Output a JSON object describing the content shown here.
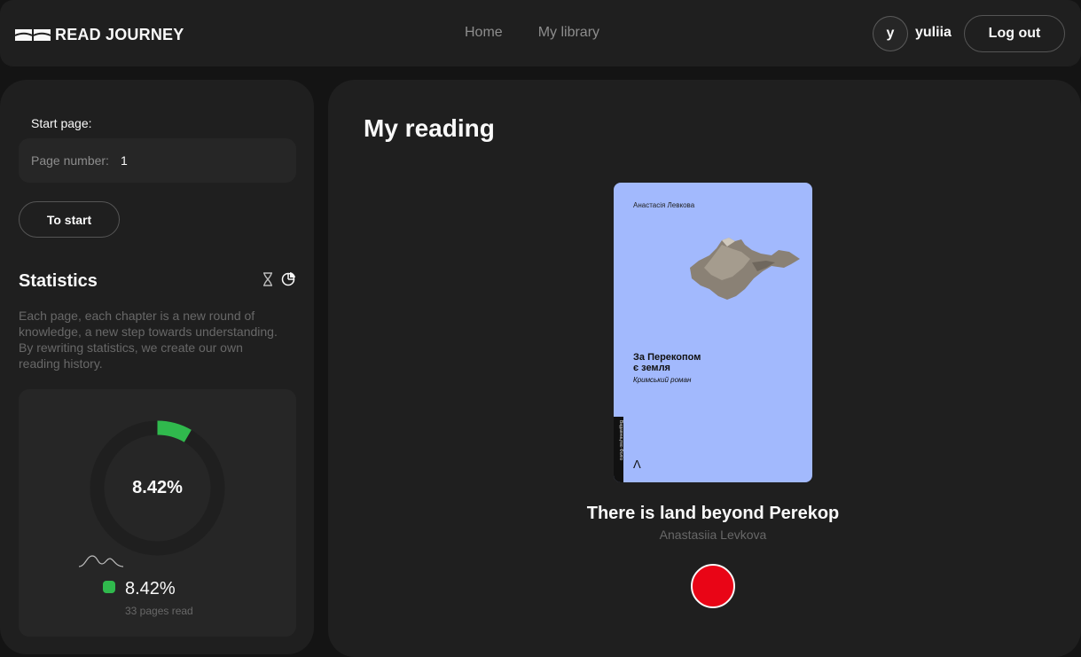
{
  "header": {
    "logo_text": "READ JOURNEY",
    "nav": [
      "Home",
      "My library"
    ],
    "user_initial": "y",
    "user_name": "yuliia",
    "logout_label": "Log out"
  },
  "sidebar": {
    "start_label": "Start page:",
    "page_input": {
      "placeholder": "Page number:",
      "value": "1"
    },
    "to_start_label": "To start",
    "stats_title": "Statistics",
    "stats_desc": "Each page, each chapter is a new round of knowledge, a new step towards understanding. By rewriting statistics, we create our own reading history.",
    "progress": {
      "percent_text": "8.42%",
      "fraction": 0.0842,
      "pages_read": "33 pages read"
    }
  },
  "main": {
    "title": "My reading",
    "book": {
      "title": "There is land beyond Perekop",
      "author": "Anastasiia Levkova",
      "cover": {
        "author": "Анастасія Левкова",
        "title": "За Перекопом\nє земля",
        "subtitle": "Кримський роман",
        "spine": "Видавництво Фоліо"
      }
    }
  },
  "colors": {
    "background": "#141414",
    "panel": "#1f1f1f",
    "field": "#262626",
    "accent_green": "#30b94d",
    "record_red": "#e90516",
    "cover_blue": "#a2b9fd"
  },
  "icons": [
    "logo-book-icon",
    "hourglass-icon",
    "pie-chart-icon",
    "wave-icon",
    "record-icon"
  ]
}
